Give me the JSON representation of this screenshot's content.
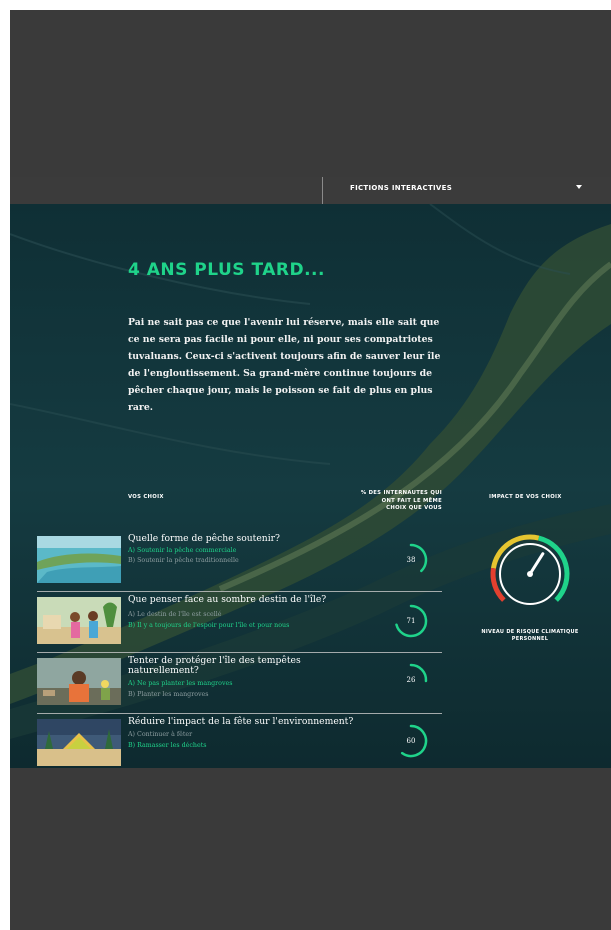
{
  "nav": {
    "menu_label": "FICTIONS INTERACTIVES"
  },
  "story": {
    "title": "4 ANS PLUS TARD...",
    "intro": "Pai ne sait pas ce que l'avenir lui réserve, mais elle sait que ce ne sera pas facile ni pour elle, ni pour ses compatriotes tuvaluans. Ceux-ci s'activent toujours afin de sauver leur île de l'engloutissement. Sa grand-mère continue toujours de pêcher chaque jour, mais le poisson se fait de plus en plus rare."
  },
  "headers": {
    "choices": "VOS CHOIX",
    "percent": "% DES INTERNAUTES QUI ONT FAIT LE MÊME CHOIX QUE VOUS",
    "impact": "IMPACT DE VOS CHOIX"
  },
  "choices": [
    {
      "question": "Quelle forme de pêche soutenir?",
      "options": [
        {
          "text": "A) Soutenir la pêche commerciale",
          "selected": true
        },
        {
          "text": "B) Soutenir la pêche traditionnelle",
          "selected": false
        }
      ],
      "percent": 38
    },
    {
      "question": "Que penser face au sombre destin de l'île?",
      "options": [
        {
          "text": "A) Le destin de l'île est scellé",
          "selected": false
        },
        {
          "text": "B) Il y a toujours de l'espoir pour l'île et pour nous",
          "selected": true
        }
      ],
      "percent": 71
    },
    {
      "question": "Tenter de protéger l'île des tempêtes naturellement?",
      "options": [
        {
          "text": "A) Ne pas planter les mangroves",
          "selected": true
        },
        {
          "text": "B) Planter les mangroves",
          "selected": false
        }
      ],
      "percent": 26
    },
    {
      "question": "Réduire l'impact de la fête sur l'environnement?",
      "options": [
        {
          "text": "A) Continuer à fêter",
          "selected": false
        },
        {
          "text": "B) Ramasser les déchets",
          "selected": true
        }
      ],
      "percent": 60
    }
  ],
  "gauge": {
    "label": "NIVEAU DE RISQUE CLIMATIQUE PERSONNEL",
    "level": 0.62
  },
  "colors": {
    "accent": "#1fd38a",
    "risk_low": "#1fd38a",
    "risk_mid": "#e6c530",
    "risk_high": "#e2402f"
  }
}
